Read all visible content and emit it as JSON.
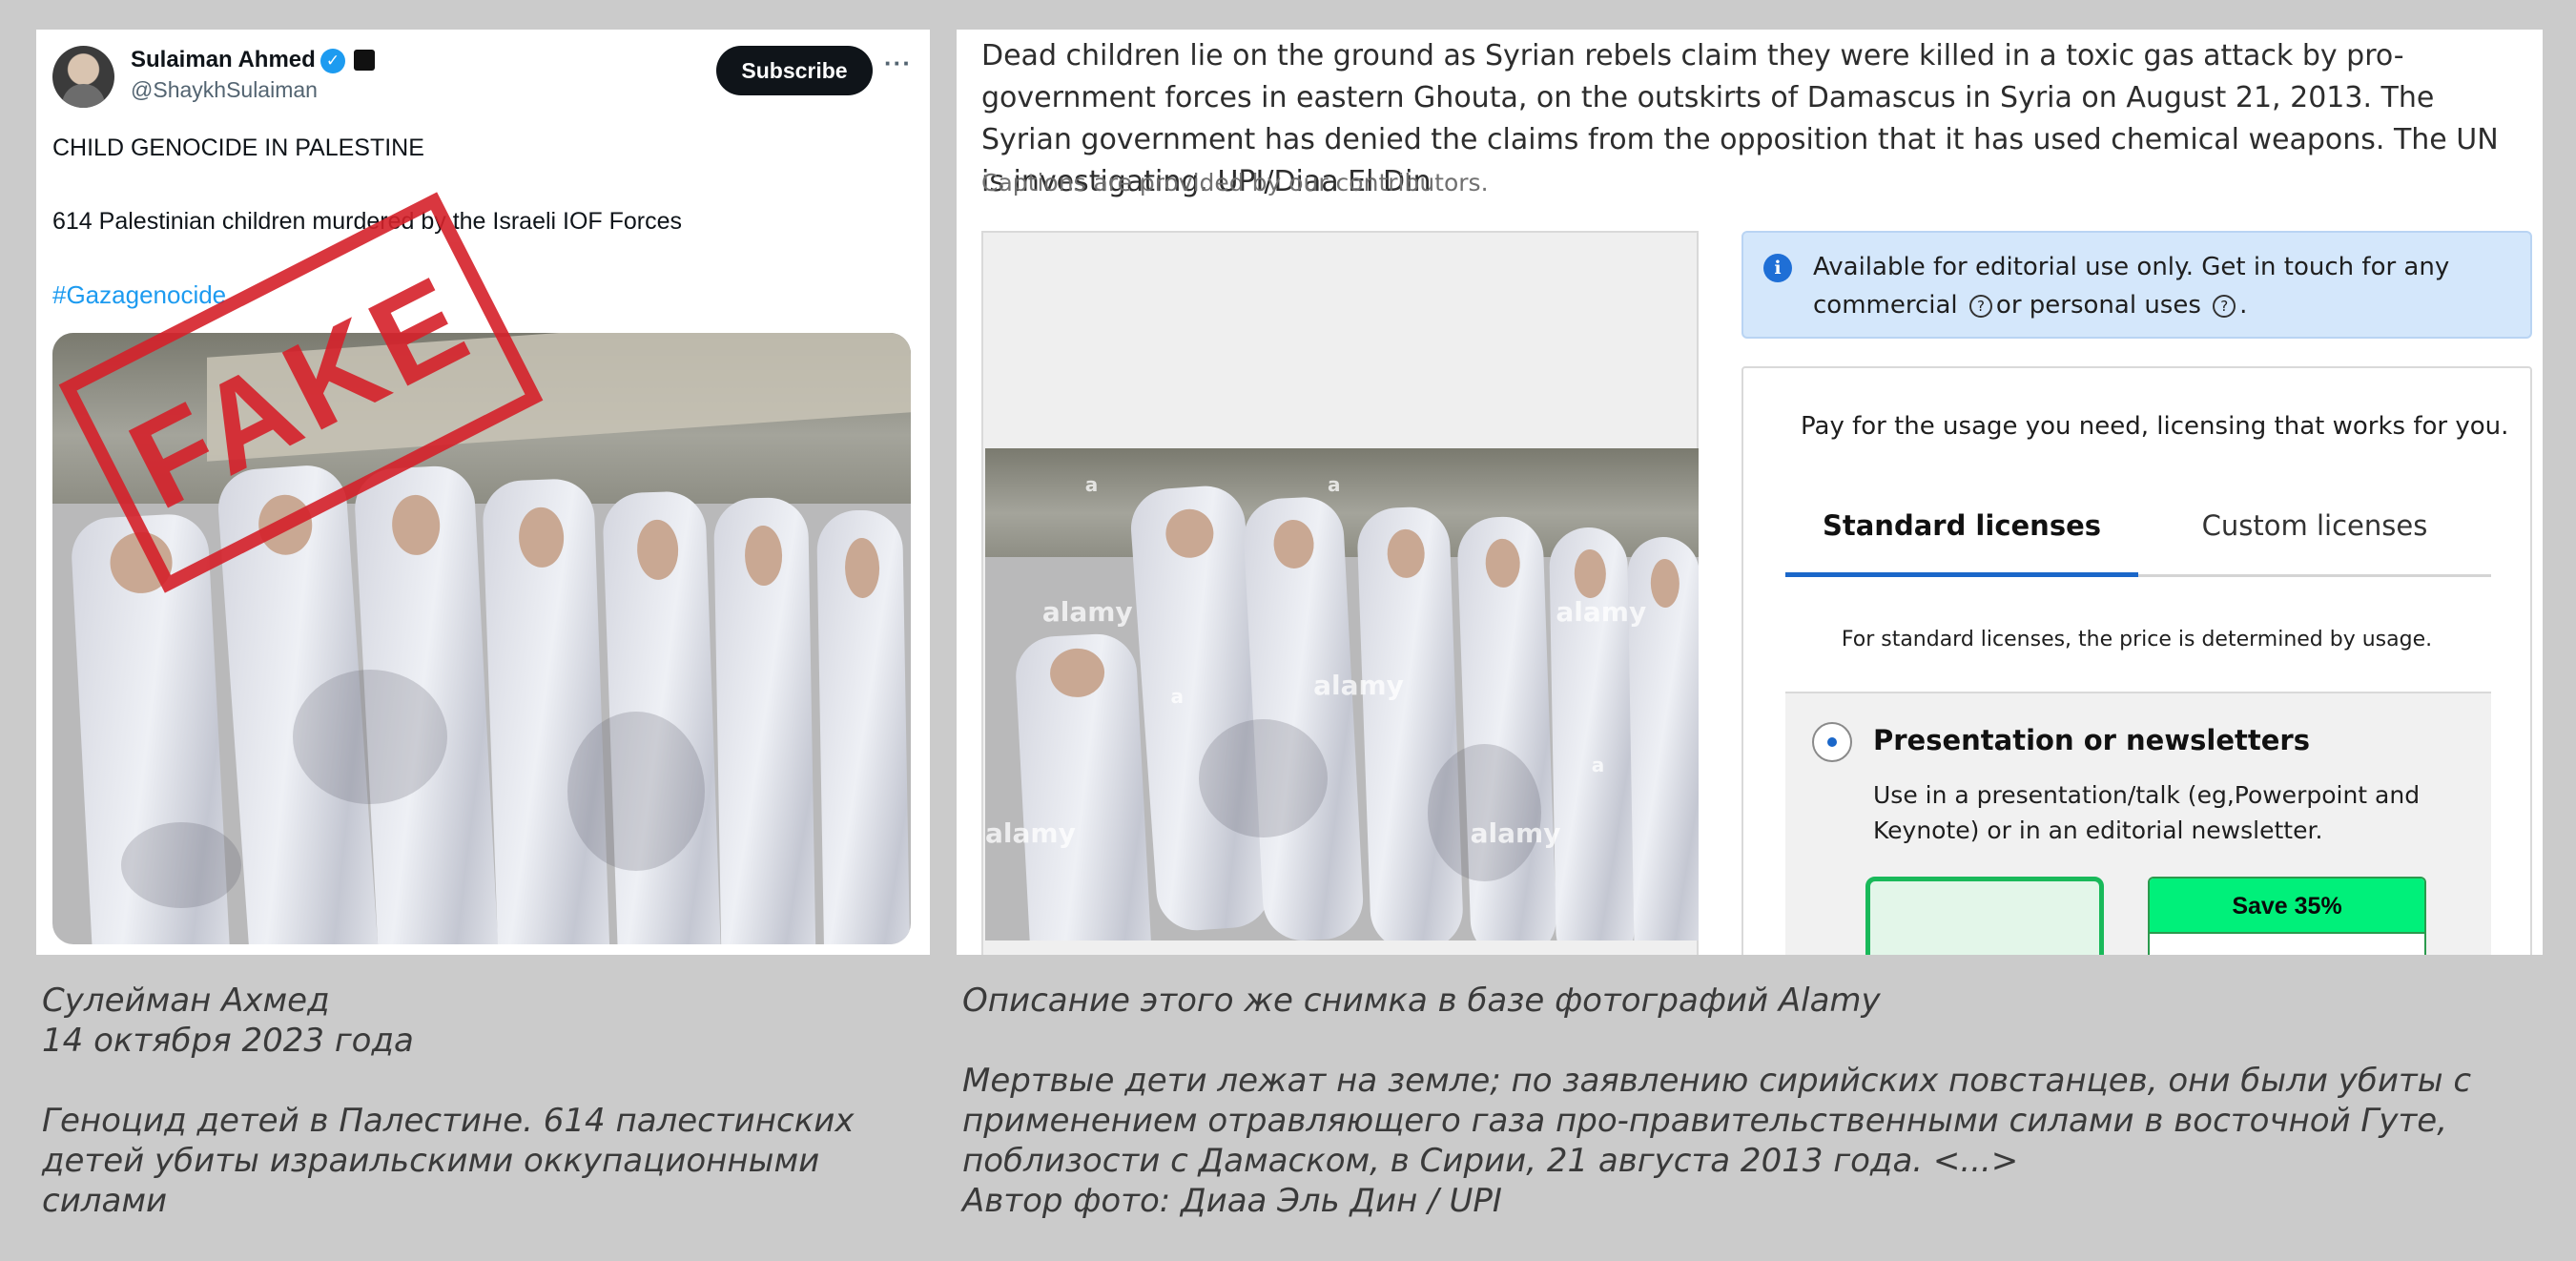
{
  "tweet": {
    "name": "Sulaiman Ahmed",
    "handle": "@ShaykhSulaiman",
    "subscribe_label": "Subscribe",
    "more_label": "···",
    "verified_glyph": "✓",
    "line1": "CHILD GENOCIDE IN PALESTINE",
    "line2": "614 Palestinian children murdered by the Israeli IOF Forces",
    "hashtag": "#Gazagenocide",
    "stamp": "FAKE",
    "stamp_color": "#d5212a",
    "link_color": "#1d9bf0"
  },
  "alamy": {
    "caption": "Dead children lie on the ground as Syrian rebels claim they were killed in a toxic gas attack by pro-government forces in eastern Ghouta, on the outskirts of Damascus in Syria on August 21, 2013. The Syrian government has denied the claims from the opposition that it has used chemical weapons. The UN is investigating. UPI/Diaa El Din",
    "contributors_note": "Captions are provided by our contributors.",
    "watermark": "alamy",
    "watermark_small": "a",
    "info": {
      "text_part1": "Available for editorial use only. Get in touch for any commercial",
      "text_part2": "or personal uses",
      "text_end": ".",
      "info_glyph": "i",
      "help_glyph": "?"
    },
    "license": {
      "title": "Pay for the usage you need, licensing that works for you.",
      "tabs": [
        "Standard licenses",
        "Custom licenses"
      ],
      "active_tab": "Standard licenses",
      "standard_note": "For standard licenses, the price is determined by usage.",
      "option_title": "Presentation or newsletters",
      "option_desc": "Use in a presentation/talk (eg,Powerpoint and Keynote) or in an editorial newsletter.",
      "save_badge": "Save 35%"
    },
    "accent_color": "#1b67c9",
    "save_color": "#00f07a"
  },
  "captions_ru": {
    "left": "Сулейман Ахмед\n14 октября 2023 года\n\nГеноцид детей в Палестине. 614 палестинских детей убиты израильскими оккупационными силами",
    "right": "Описание этого же снимка в базе фотографий Alamy\n\nМертвые дети лежат на земле; по заявлению сирийских повстанцев, они были убиты с применением отравляющего газа про-правительственными силами в восточной Гуте, поблизости с Дамаском, в Сирии, 21 августа 2013 года. <...>\nАвтор фото: Диаа Эль Дин / UPI"
  }
}
